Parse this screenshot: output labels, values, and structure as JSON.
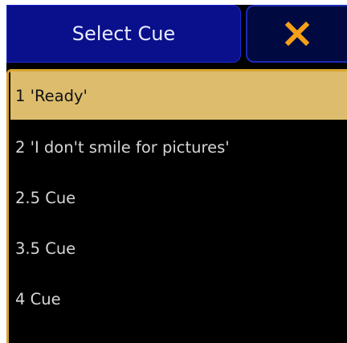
{
  "dialog": {
    "title": "Select Cue",
    "close_icon": "close-x-icon",
    "accent_color": "#ddbd6d",
    "title_color": "#0a0f8c",
    "close_color": "#f5a019"
  },
  "cues": [
    {
      "label": "1 'Ready'",
      "selected": true
    },
    {
      "label": "2 'I don't smile for pictures'",
      "selected": false
    },
    {
      "label": "2.5 Cue",
      "selected": false
    },
    {
      "label": "3.5 Cue",
      "selected": false
    },
    {
      "label": "4 Cue",
      "selected": false
    }
  ]
}
